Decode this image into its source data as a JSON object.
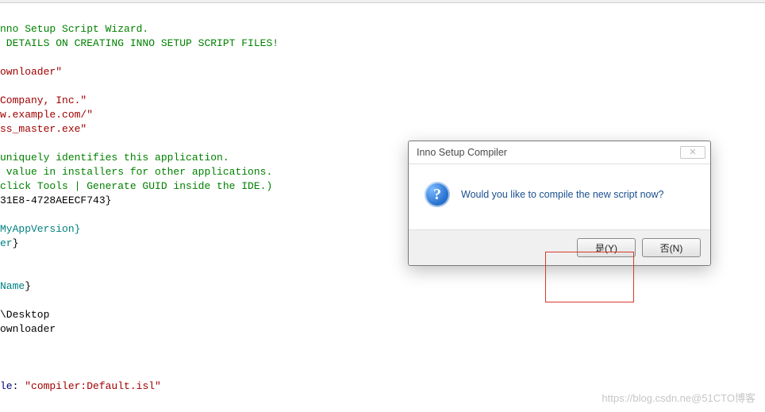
{
  "code": {
    "l1": "nno Setup Script Wizard.",
    "l2": " DETAILS ON CREATING INNO SETUP SCRIPT FILES!",
    "l3": "ownloader\"",
    "l4": "Company, Inc.\"",
    "l5": "w.example.com/\"",
    "l6": "ss_master.exe\"",
    "l7": "uniquely identifies this application.",
    "l8": " value in installers for other applications.",
    "l9": "click Tools | Generate GUID inside the IDE.)",
    "l10": "31E8-4728AEECF743}",
    "l11": "MyAppVersion}",
    "l12": "er",
    "l12b": "}",
    "l13": "Name",
    "l13b": "}",
    "l14": "\\Desktop",
    "l15": "ownloader",
    "l16a": "le",
    "l16b": ": ",
    "l16c": "\"compiler:Default.isl\""
  },
  "dialog": {
    "title": "Inno Setup Compiler",
    "close": "✕",
    "icon_char": "?",
    "message": "Would you like to compile the new script now?",
    "yes": "是(Y)",
    "no": "否(N)"
  },
  "watermark": "https://blog.csdn.ne@51CTO博客"
}
